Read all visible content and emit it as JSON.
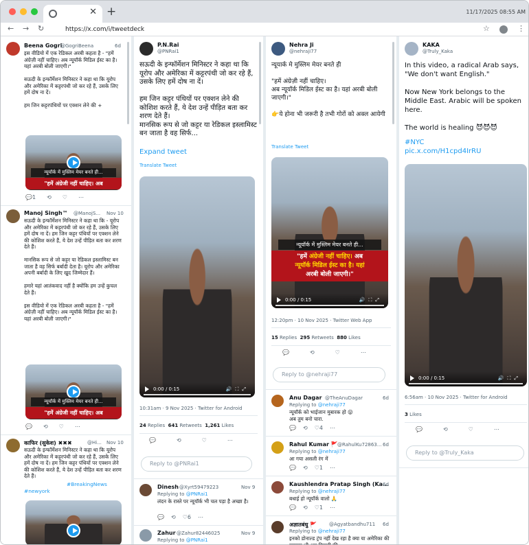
{
  "browser": {
    "tab_title": "",
    "url": "https://x.com/i/tweetdeck",
    "clock": "11/17/2025 08:55 AM"
  },
  "col1": {
    "t1": {
      "name": "Beena Gogri",
      "handle": "@GogriBeena",
      "time": "6d",
      "text": "इस वीडियो में एक रेडिकल अरबी कहता है - \"हमें अंग्रेज़ी नहीं चाहिए। अब न्यूयॉर्क मिडिल ईस्ट का है। यहां अरबी बोली जाएगी।\"\n\nसऊदी के इन्फॉर्मेशन मिनिस्टर ने कहा था कि यूरोप और अमेरिका में कट्टरपंथी जो कर रहे हैं, उसके लिए हमें दोष ना दें।\n\nहम जिन कट्टरपंथियों पर एक्शन लेने की +",
      "media_caption": "न्यूयॉर्क में मुस्लिम मेयर बनते ही...",
      "media_red": "\"हमें अंग्रेजी नहीं चाहिए। अब",
      "counts": [
        "1",
        "",
        ""
      ]
    },
    "t2": {
      "name": "Manoj Singh™",
      "handle": "@ManojS...",
      "time": "Nov 10",
      "text": "सऊदी के इन्फॉर्मेशन मिनिस्टर ने कहा था कि - यूरोप और अमेरिका में कट्टरपंथी जो कर रहे हैं, उसके लिए हमें दोष ना दें। हम जिन कट्टर पंथियों पर एक्शन लेने की कोशिश करते हैं, ये देश उन्हें पीड़ित बता कर शरण देते हैं।\n\n  मानसिक रूप से जो कट्टर या रेडिकल इस्लामिस्ट बन जाता है वह सिर्फ बर्बादी देता है। यूरोप और अमेरिका अपनी बर्बादी के लिए खुद जिम्मेदार हैं।\n\n  हमारे यहां आतंकवाद नहीं है क्योंकि हम उन्हें कुचल देते हैं।\n\nइस वीडियो में एक रेडिकल अरबी कहता है - \"हमें अंग्रेज़ी नहीं चाहिए। अब न्यूयॉर्क मिडिल ईस्ट का है। यहां अरबी बोली जाएगी।\"",
      "media_caption": "न्यूयॉर्क में मुस्लिम मेयर बनते ही...",
      "media_red": "\"हमें अंग्रेजी नहीं चाहिए। अब"
    },
    "t3": {
      "name": "काफिर (सुकेश) ✖✖✖",
      "handle": "@Hi...",
      "time": "Nov 10",
      "text": "सऊदी के इन्फॉर्मेशन मिनिस्टर ने कहा था कि यूरोप और अमेरिका में कट्टरपंथी जो कर रहे हैं, उसके लिए हमें दोष ना दें। हम जिन कट्टर पंथियों पर एक्शन लेने की कोशिश करते हैं, ये देश उन्हें पीड़ित बता कर शरण देते हैं।",
      "tag1": "#BreakingNews",
      "tag2": "#newyork"
    }
  },
  "col2": {
    "name": "P.N.Rai",
    "handle": "@PNRai1",
    "text": "सऊदी के इन्फॉर्मेशन मिनिस्टर ने कहा था कि यूरोप और अमेरिका में कट्टरपंथी जो कर रहे हैं, उसके लिए हमें दोष ना दें।\n\nहम जिन कट्टर पंथियों पर एक्शन लेने की कोशिश करते हैं, ये देश उन्हें पीड़ित बता कर शरण देते हैं।\nमानसिक रूप से जो कट्टर या रेडिकल इस्लामिस्ट बन जाता है वह सिर्फ...",
    "expand": "Expand tweet",
    "translate": "Translate Tweet",
    "video_time": "0:00 / 0:15",
    "meta": "10:31am · 9 Nov 2025 · Twitter for Android",
    "replies": "24",
    "replies_l": "Replies",
    "retweets": "641",
    "retweets_l": "Retweets",
    "likes": "1,261",
    "likes_l": "Likes",
    "reply_ph": "Reply to @PNRai1",
    "r1": {
      "name": "Dinesh",
      "handle": "@Xyrt59479223",
      "time": "Nov 9",
      "replying": "Replying to",
      "to": "@PNRai1",
      "text": "लंदन के रास्ते पर न्यूयॉर्क भी चल पड़ा है अच्छा है।",
      "c": "6"
    },
    "r2": {
      "name": "Zahur",
      "handle": "@Zahur82446025",
      "time": "Nov 9",
      "replying": "Replying to",
      "to": "@PNRai1"
    }
  },
  "col3": {
    "name": "Nehra Ji",
    "handle": "@nehraji77",
    "text": "न्यूयार्क मे मुस्लिम मेयर बनते ही\n\n\"हमें अंग्रेज़ी नहीं चाहिए।\nअब न्यूयॉर्क मिडिल ईस्ट का है। यहां अरबी बोली जाएगी।\"\n\n👉ये होना भी जरूरी है तभी गोरों को अक्ल आयेगी",
    "translate": "Translate Tweet",
    "cap1": "न्यूयॉर्क में मुस्लिम मेयर बनते ही...",
    "red_a": "\"हमें ",
    "red_b": "अंग्रेजी नहीं चाहिए।",
    "red_c": " अब",
    "red_d": "न्यूयॉर्क मिडिल ईस्ट का है। यहां",
    "red_e": "अरबी बोली जाएगी।\"",
    "video_time": "0:00 / 0:15",
    "meta": "12:20pm · 10 Nov 2025 · Twitter Web App",
    "replies": "15",
    "replies_l": "Replies",
    "retweets": "295",
    "retweets_l": "Retweets",
    "likes": "880",
    "likes_l": "Likes",
    "reply_ph": "Reply to @nehraji77",
    "r1": {
      "name": "Anu Dagar",
      "handle": "@TheAnuDagar",
      "time": "6d",
      "replying": "Replying to",
      "to": "@nehraji77",
      "text": "न्यूयॉर्क को भाईजान मुबारक हो 😛\nअब तुम बनो चारा.",
      "c": "4"
    },
    "r2": {
      "name": "Rahul Kumar 🚩",
      "handle": "@RahulKu72863...",
      "time": "6d",
      "replying": "Replying to",
      "to": "@nehraji77",
      "text": "आ गया असली रंग में",
      "c": "1"
    },
    "r3": {
      "name": "Kaushlendra Pratap Singh (Ka...",
      "handle": "",
      "time": "6d",
      "replying": "Replying to",
      "to": "@nehraji77",
      "text": "बधाई हो न्यूयॉर्क वालो 🙏",
      "c": "1"
    },
    "r4": {
      "name": "अज्ञातबंधु 🚩",
      "handle": "@Agyatbandhu711",
      "time": "6d",
      "replying": "Replying to",
      "to": "@nehraji77",
      "text": "इनको डोनाल्ड ट्रंप नहीं देख रहा है क्या या अमेरिका की सरकार भी अब डिरगरी की"
    }
  },
  "col4": {
    "name": "KAKA",
    "handle": "@Truly_Kaka",
    "text": "In this video, a radical Arab says, \"We don't want English.\"\n\nNow New York belongs to the Middle East. Arabic will be spoken here.\n\nThe world is healing 😈😈😈",
    "tag": "#NYC",
    "link": "pic.x.com/H1cpd4IrRU",
    "video_time": "0:00 / 0:15",
    "meta": "6:56am · 10 Nov 2025 · Twitter for Android",
    "likes": "3",
    "likes_l": "Likes",
    "reply_ph": "Reply to @Truly_Kaka"
  }
}
